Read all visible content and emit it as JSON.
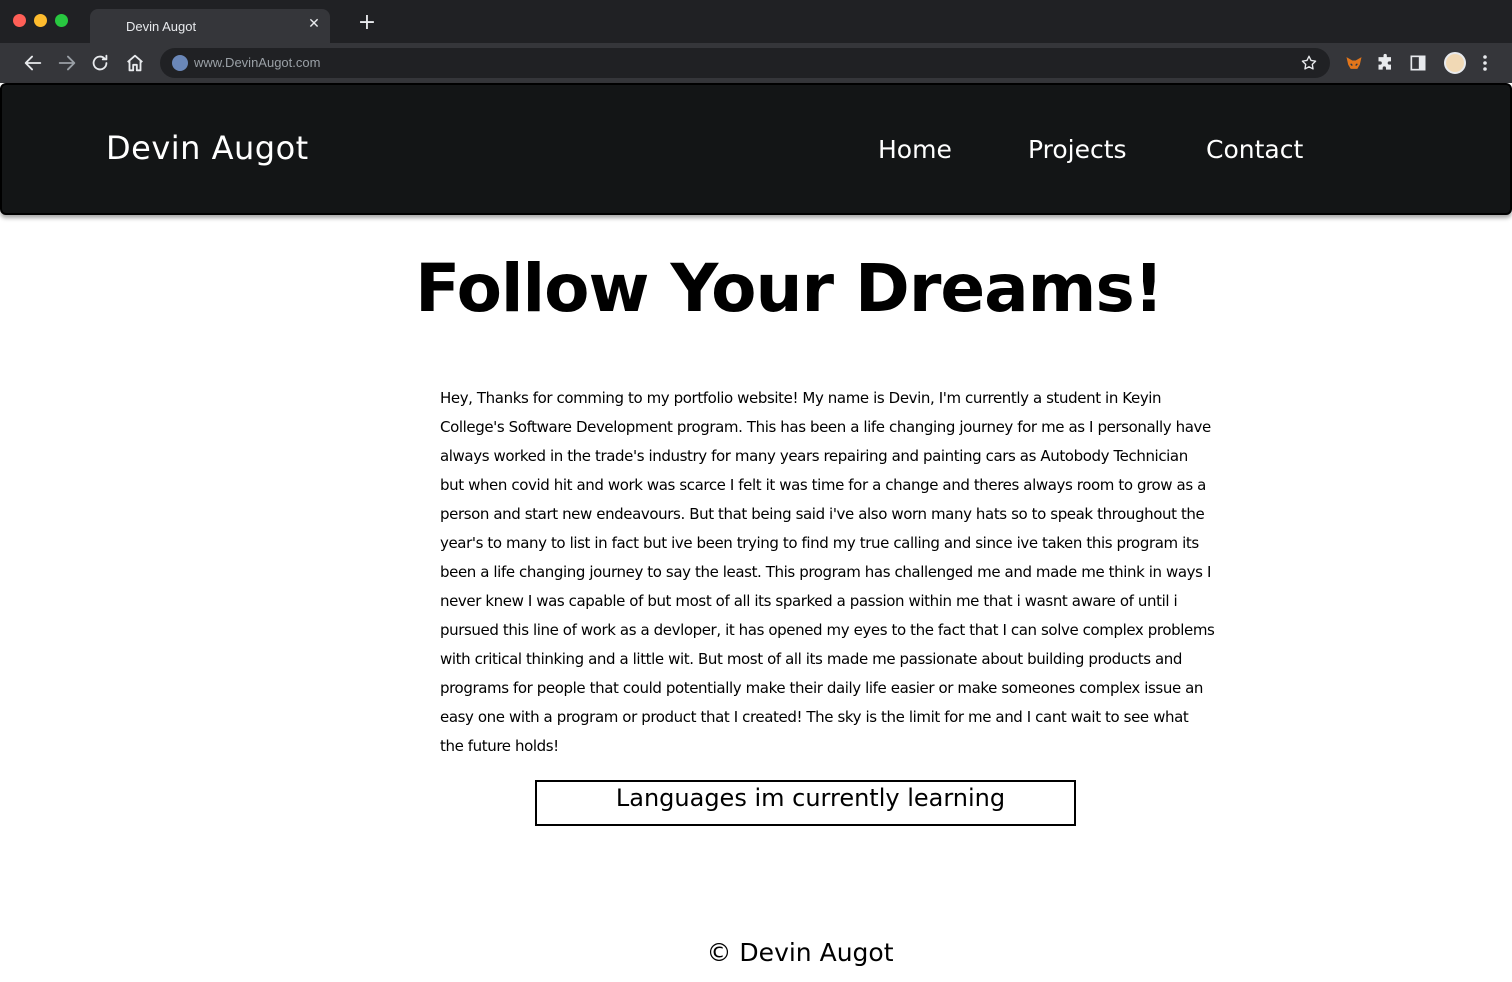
{
  "browser": {
    "tab_title": "Devin Augot",
    "tab_close": "✕",
    "new_tab": "+",
    "url": "www.DevinAugot.com"
  },
  "header": {
    "brand": "Devin Augot",
    "nav": [
      {
        "label": "Home"
      },
      {
        "label": "Projects"
      },
      {
        "label": "Contact"
      }
    ]
  },
  "main": {
    "title": "Follow Your Dreams!",
    "bio": "Hey, Thanks for comming to my portfolio website! My name is Devin, I'm currently a student in Keyin College's Software Development program. This has been a life changing journey for me as I personally have always worked in the trade's industry for many years repairing and painting cars as Autobody Technician but when covid hit and work was scarce I felt it was time for a change and theres always room to grow as a person and start new endeavours. But that being said i've also worn many hats so to speak throughout the year's to many to list in fact but ive been trying to find my true calling and since ive taken this program its been a life changing journey to say the least. This program has challenged me and made me think in ways I never knew I was capable of but most of all its sparked a passion within me that i wasnt aware of until i pursued this line of work as a devloper, it has opened my eyes to the fact that I can solve complex problems with critical thinking and a little wit. But most of all its made me passionate about building products and programs for people that could potentially make their daily life easier or make someones complex issue an easy one with a program or product that I created! The sky is the limit for me and I cant wait to see what the future holds!",
    "languages_title": "Languages im currently learning"
  },
  "footer": {
    "copyright": "© Devin Augot"
  },
  "colors": {
    "header_bg": "#131516",
    "chrome_dark": "#202124",
    "chrome_mid": "#35363a"
  }
}
